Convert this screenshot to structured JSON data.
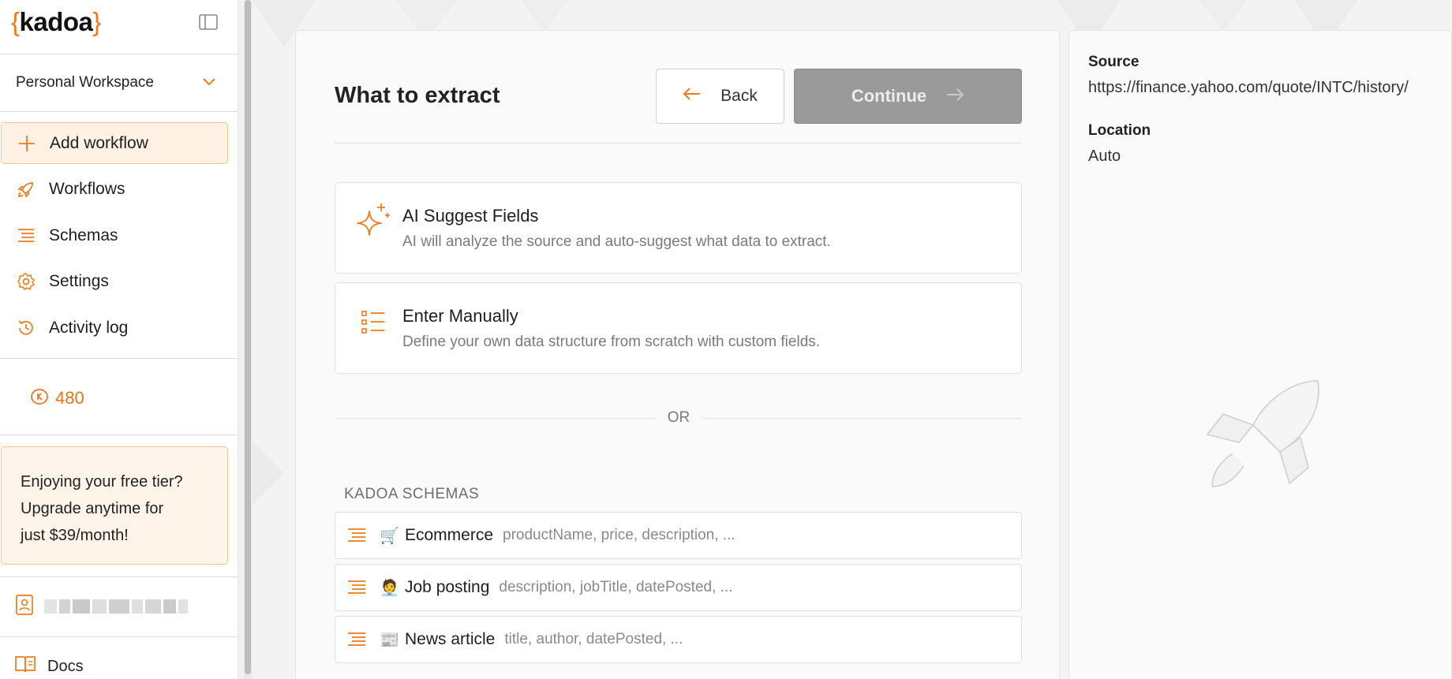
{
  "brand": {
    "open": "{",
    "name": "kadoa",
    "close": "}"
  },
  "sidebar": {
    "workspace": "Personal Workspace",
    "nav": [
      {
        "label": "Add workflow",
        "icon": "plus-icon"
      },
      {
        "label": "Workflows",
        "icon": "rocket-icon"
      },
      {
        "label": "Schemas",
        "icon": "schema-list-icon"
      },
      {
        "label": "Settings",
        "icon": "gear-icon"
      },
      {
        "label": "Activity log",
        "icon": "history-icon"
      }
    ],
    "credits": "480",
    "promo": {
      "line1": "Enjoying your free tier?",
      "line2": "Upgrade anytime for",
      "line3": "just $39/month!"
    },
    "docs": "Docs"
  },
  "main": {
    "title": "What to extract",
    "back_label": "Back",
    "continue_label": "Continue",
    "options": [
      {
        "title": "AI Suggest Fields",
        "desc": "AI will analyze the source and auto-suggest what data to extract."
      },
      {
        "title": "Enter Manually",
        "desc": "Define your own data structure from scratch with custom fields."
      }
    ],
    "or_label": "OR",
    "schemas_heading": "KADOA SCHEMAS",
    "schemas": [
      {
        "emoji": "🛒",
        "name": "Ecommerce",
        "fields": "productName, price, description, ..."
      },
      {
        "emoji": "🧑‍💼",
        "name": "Job posting",
        "fields": "description, jobTitle, datePosted, ..."
      },
      {
        "emoji": "📰",
        "name": "News article",
        "fields": "title, author, datePosted, ..."
      }
    ]
  },
  "details": {
    "source_label": "Source",
    "source_value": "https://finance.yahoo.com/quote/INTC/history/",
    "location_label": "Location",
    "location_value": "Auto"
  },
  "colors": {
    "accent": "#f07a1a",
    "disabled": "#9a9a9a"
  }
}
